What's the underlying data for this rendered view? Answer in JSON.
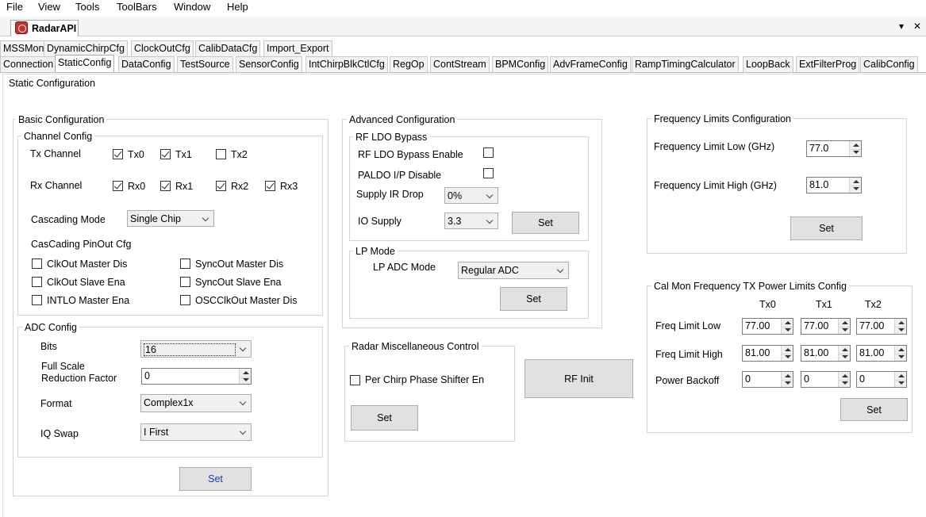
{
  "menu": [
    "File",
    "View",
    "Tools",
    "ToolBars",
    "Window",
    "Help"
  ],
  "app_tab": "RadarAPI",
  "window_controls": {
    "dropdown": "▾",
    "close": "✕"
  },
  "tabs_row1": [
    "MSSMon",
    "DynamicChirpCfg",
    "ClockOutCfg",
    "CalibDataCfg",
    "Import_Export"
  ],
  "tabs_row2": [
    "Connection",
    "StaticConfig",
    "DataConfig",
    "TestSource",
    "SensorConfig",
    "IntChirpBlkCtlCfg",
    "RegOp",
    "ContStream",
    "BPMConfig",
    "AdvFrameConfig",
    "RampTimingCalculator",
    "LoopBack",
    "ExtFilterProg",
    "CalibConfig"
  ],
  "active_tab": "StaticConfig",
  "page_title": "Static Configuration",
  "basic": {
    "title": "Basic Configuration",
    "channel_config": "Channel Config",
    "tx_label": "Tx Channel",
    "tx": [
      {
        "label": "Tx0",
        "checked": true
      },
      {
        "label": "Tx1",
        "checked": true
      },
      {
        "label": "Tx2",
        "checked": false
      }
    ],
    "rx_label": "Rx Channel",
    "rx": [
      {
        "label": "Rx0",
        "checked": true
      },
      {
        "label": "Rx1",
        "checked": true
      },
      {
        "label": "Rx2",
        "checked": true
      },
      {
        "label": "Rx3",
        "checked": true
      }
    ],
    "cascading_mode_label": "Cascading Mode",
    "cascading_mode_value": "Single Chip",
    "pinout_label": "CasCading PinOut Cfg",
    "pinout": [
      {
        "label": "ClkOut Master Dis",
        "checked": false
      },
      {
        "label": "SyncOut Master Dis",
        "checked": false
      },
      {
        "label": "ClkOut Slave Ena",
        "checked": false
      },
      {
        "label": "SyncOut Slave Ena",
        "checked": false
      },
      {
        "label": "INTLO Master Ena",
        "checked": false
      },
      {
        "label": "OSCClkOut Master Dis",
        "checked": false
      }
    ],
    "adc": {
      "title": "ADC Config",
      "bits_label": "Bits",
      "bits_value": "16",
      "fsrf_label_1": "Full Scale",
      "fsrf_label_2": "Reduction Factor",
      "fsrf_value": "0",
      "format_label": "Format",
      "format_value": "Complex1x",
      "iq_label": "IQ Swap",
      "iq_value": "I First"
    },
    "set_label": "Set"
  },
  "advanced": {
    "title": "Advanced Configuration",
    "rfldo_title": "RF LDO Bypass",
    "rfldo_enable_label": "RF LDO Bypass Enable",
    "rfldo_enable_checked": false,
    "paldo_label": "PALDO I/P Disable",
    "paldo_checked": false,
    "supply_ir_label": "Supply IR Drop",
    "supply_ir_value": "0%",
    "io_supply_label": "IO Supply",
    "io_supply_value": "3.3",
    "rfldo_set": "Set",
    "lp_title": "LP Mode",
    "lp_adc_label": "LP ADC Mode",
    "lp_adc_value": "Regular ADC",
    "lp_set": "Set"
  },
  "misc": {
    "title": "Radar Miscellaneous Control",
    "phase_shifter_label": "Per Chirp Phase Shifter En",
    "phase_shifter_checked": false,
    "set_label": "Set"
  },
  "rf_init_label": "RF Init",
  "freq_limits": {
    "title": "Frequency Limits Configuration",
    "low_label": "Frequency Limit Low (GHz)",
    "low_value": "77.0",
    "high_label": "Frequency Limit High (GHz)",
    "high_value": "81.0",
    "set_label": "Set"
  },
  "calmon": {
    "title": "Cal Mon Frequency TX Power Limits Config",
    "columns": [
      "Tx0",
      "Tx1",
      "Tx2"
    ],
    "rows": [
      {
        "label": "Freq Limit Low",
        "values": [
          "77.00",
          "77.00",
          "77.00"
        ]
      },
      {
        "label": "Freq Limit High",
        "values": [
          "81.00",
          "81.00",
          "81.00"
        ]
      },
      {
        "label": "Power Backoff",
        "values": [
          "0",
          "0",
          "0"
        ]
      }
    ],
    "set_label": "Set"
  }
}
